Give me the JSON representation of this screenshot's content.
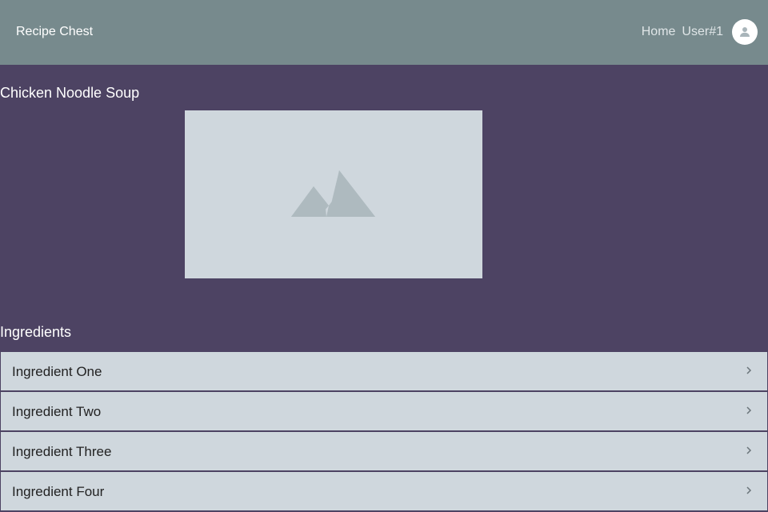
{
  "app": {
    "title": "Recipe Chest"
  },
  "nav": {
    "home": "Home",
    "user": "User#1"
  },
  "icons": {
    "avatar": "account-circle-icon",
    "image_placeholder": "image-placeholder-icon",
    "chevron": "chevron-right-icon"
  },
  "recipe": {
    "title": "Chicken Noodle Soup"
  },
  "ingredients": {
    "heading": "Ingredients",
    "items": [
      {
        "label": "Ingredient One"
      },
      {
        "label": "Ingredient Two"
      },
      {
        "label": "Ingredient Three"
      },
      {
        "label": "Ingredient Four"
      }
    ]
  },
  "colors": {
    "appbar": "#778a8d",
    "background": "#4d4363",
    "card": "#cfd7dd"
  }
}
